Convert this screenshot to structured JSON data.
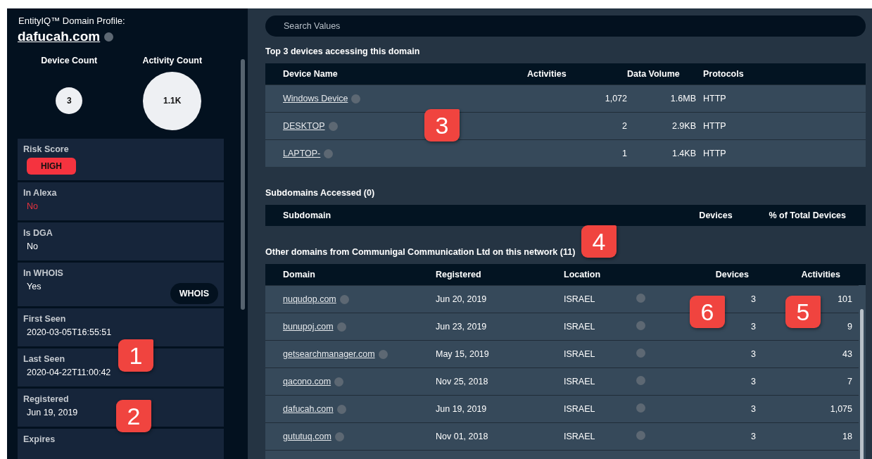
{
  "profile": {
    "caption": "EntityIQ™ Domain Profile:",
    "domain": "dafucah.com"
  },
  "counts": [
    {
      "label": "Device Count",
      "value": "3",
      "kind": "small"
    },
    {
      "label": "Activity Count",
      "value": "1.1K",
      "kind": "large"
    }
  ],
  "fields": [
    {
      "label": "Risk Score",
      "value": "HIGH",
      "kind": "badge",
      "alert": true
    },
    {
      "label": "In Alexa",
      "value": "No",
      "kind": "text",
      "alert": true
    },
    {
      "label": "Is DGA",
      "value": "No",
      "kind": "text",
      "alert": false
    },
    {
      "label": "In WHOIS",
      "value": "Yes",
      "kind": "button",
      "button": "WHOIS",
      "alert": false
    },
    {
      "label": "First Seen",
      "value": "2020-03-05T16:55:51",
      "kind": "text",
      "alert": false
    },
    {
      "label": "Last Seen",
      "value": "2020-04-22T11:00:42",
      "kind": "text",
      "alert": false
    },
    {
      "label": "Registered",
      "value": "Jun 19, 2019",
      "kind": "text",
      "alert": false
    },
    {
      "label": "Expires",
      "kind": "text"
    }
  ],
  "search": {
    "placeholder": "Search Values"
  },
  "devices": {
    "title": "Top 3 devices accessing this domain",
    "columns": [
      "Device Name",
      "Activities",
      "Data Volume",
      "Protocols"
    ],
    "rows": [
      {
        "name": "Windows Device",
        "activities": "1,072",
        "data_volume": "1.6MB",
        "protocol": "HTTP"
      },
      {
        "name": "DESKTOP",
        "activities": "2",
        "data_volume": "2.9KB",
        "protocol": "HTTP"
      },
      {
        "name": "LAPTOP-",
        "activities": "1",
        "data_volume": "1.4KB",
        "protocol": "HTTP"
      }
    ]
  },
  "subdomains": {
    "title": "Subdomains Accessed (0)",
    "columns": [
      "Subdomain",
      "Devices",
      "% of Total Devices"
    ]
  },
  "other_domains": {
    "title": "Other domains from Communigal Communication Ltd on this network (11)",
    "columns": [
      "Domain",
      "Registered",
      "Location",
      "Devices",
      "Activities"
    ],
    "rows": [
      {
        "domain": "nuqudop.com",
        "registered": "Jun 20, 2019",
        "location": "ISRAEL",
        "devices": "3",
        "activities": "101"
      },
      {
        "domain": "bunupoj.com",
        "registered": "Jun 23, 2019",
        "location": "ISRAEL",
        "devices": "3",
        "activities": "9"
      },
      {
        "domain": "getsearchmanager.com",
        "registered": "May 15, 2019",
        "location": "ISRAEL",
        "devices": "3",
        "activities": "43"
      },
      {
        "domain": "qacono.com",
        "registered": "Nov 25, 2018",
        "location": "ISRAEL",
        "devices": "3",
        "activities": "7"
      },
      {
        "domain": "dafucah.com",
        "registered": "Jun 19, 2019",
        "location": "ISRAEL",
        "devices": "3",
        "activities": "1,075"
      },
      {
        "domain": "gututuq.com",
        "registered": "Nov 01, 2018",
        "location": "ISRAEL",
        "devices": "3",
        "activities": "18"
      }
    ]
  },
  "callouts": [
    {
      "label": "1"
    },
    {
      "label": "2"
    },
    {
      "label": "3"
    },
    {
      "label": "4"
    },
    {
      "label": "6"
    },
    {
      "label": "5"
    }
  ]
}
